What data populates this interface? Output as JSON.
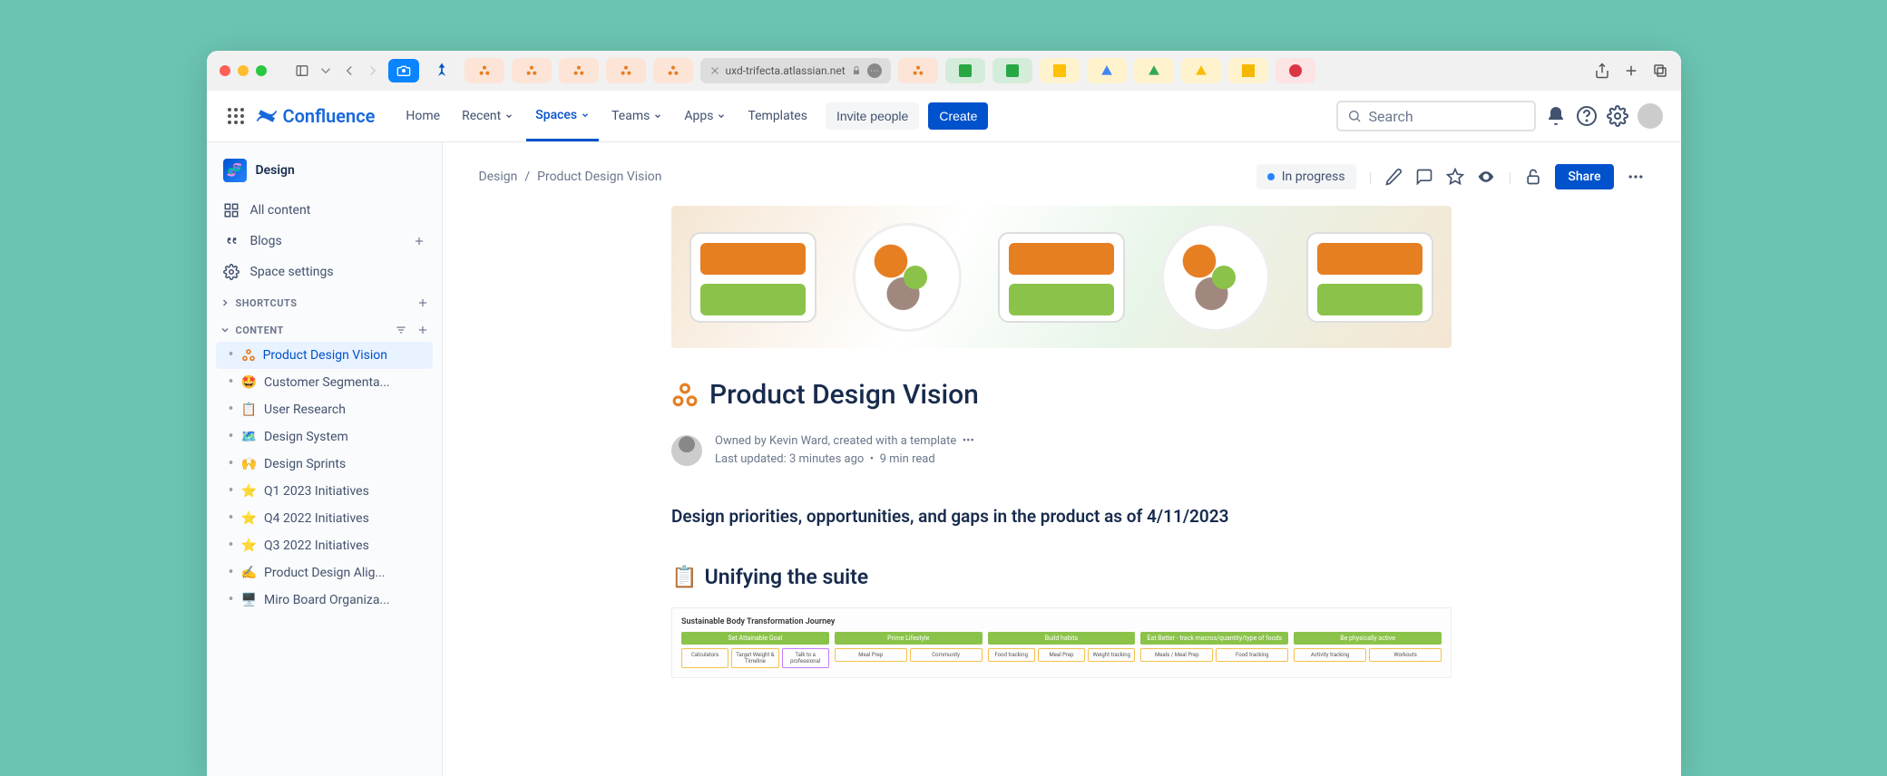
{
  "titlebar": {
    "url": "uxd-trifecta.atlassian.net"
  },
  "nav": {
    "product": "Confluence",
    "links": [
      "Home",
      "Recent",
      "Spaces",
      "Teams",
      "Apps",
      "Templates"
    ],
    "dropdown": [
      false,
      true,
      true,
      true,
      true,
      false
    ],
    "active_index": 2,
    "invite": "Invite people",
    "create": "Create",
    "search_placeholder": "Search"
  },
  "sidebar": {
    "space_name": "Design",
    "items": [
      {
        "icon": "grid",
        "label": "All content"
      },
      {
        "icon": "quote",
        "label": "Blogs",
        "add": true
      },
      {
        "icon": "gear",
        "label": "Space settings"
      }
    ],
    "shortcuts_label": "SHORTCUTS",
    "content_label": "CONTENT",
    "tree": [
      {
        "emoji": "ooo",
        "label": "Product Design Vision",
        "active": true,
        "color": "#e67e22"
      },
      {
        "emoji": "🤩",
        "label": "Customer Segmenta..."
      },
      {
        "emoji": "📋",
        "label": "User Research"
      },
      {
        "emoji": "🗺️",
        "label": "Design System"
      },
      {
        "emoji": "🙌",
        "label": "Design Sprints"
      },
      {
        "emoji": "⭐",
        "label": "Q1 2023 Initiatives"
      },
      {
        "emoji": "⭐",
        "label": "Q4 2022 Initiatives"
      },
      {
        "emoji": "⭐",
        "label": "Q3 2022 Initiatives"
      },
      {
        "emoji": "✍️",
        "label": "Product Design Alig..."
      },
      {
        "emoji": "🖥️",
        "label": "Miro Board Organiza..."
      }
    ]
  },
  "page": {
    "breadcrumbs": [
      "Design",
      "Product Design Vision"
    ],
    "status": "In progress",
    "share": "Share",
    "title": "Product Design Vision",
    "owned_by": "Owned by Kevin Ward, created with a template",
    "updated": "Last updated: 3 minutes ago",
    "read_time": "9 min read",
    "h3": "Design priorities, opportunities, and gaps in the product as of 4/11/2023",
    "h2_emoji": "📋",
    "h2": "Unifying the suite",
    "diagram": {
      "title": "Sustainable Body Transformation Journey",
      "lanes": [
        {
          "head": "Set Attainable Goal",
          "chips": [
            "Calculators",
            "Target Weight & Timeline",
            "Talk to a professional"
          ]
        },
        {
          "head": "Prime Lifestyle",
          "chips": [
            "Meal Prep",
            "Community"
          ]
        },
        {
          "head": "Build habits",
          "chips": [
            "Food tracking",
            "Meal Prep",
            "Weight tracking"
          ]
        },
        {
          "head": "Eat Better - track macros/quantity/type of foods",
          "chips": [
            "Meals / Meal Prep",
            "Food tracking"
          ]
        },
        {
          "head": "Be physically active",
          "chips": [
            "Activity tracking",
            "Workouts"
          ]
        }
      ]
    }
  }
}
